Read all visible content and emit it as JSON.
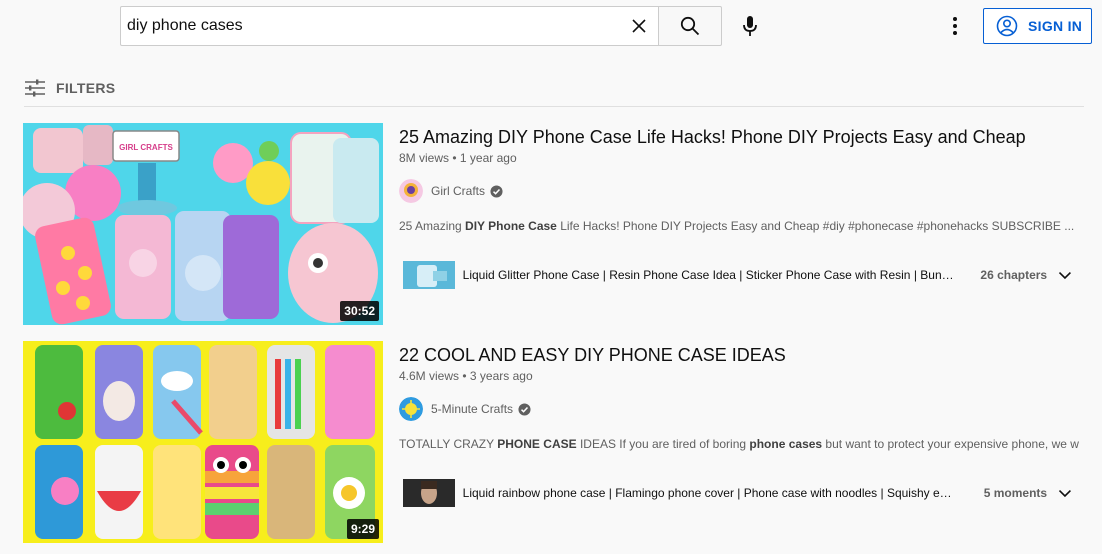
{
  "search": {
    "query": "diy phone cases"
  },
  "header": {
    "sign_in_label": "SIGN IN"
  },
  "filters": {
    "label": "FILTERS"
  },
  "results": [
    {
      "title": "25 Amazing DIY Phone Case Life Hacks! Phone DIY Projects Easy and Cheap",
      "views": "8M views",
      "age": "1 year ago",
      "channel": "Girl Crafts",
      "duration": "30:52",
      "thumb_text": "GIRL CRAFTS",
      "desc_parts": [
        "25 Amazing ",
        "DIY Phone Case",
        " Life Hacks! Phone DIY Projects Easy and Cheap #diy #phonecase #phonehacks SUBSCRIBE ..."
      ],
      "chapter_text": "Liquid Glitter Phone Case | Resin Phone Case Idea | Sticker Phone Case with Resin | Bunny Phone Case",
      "chapter_count": "26 chapters"
    },
    {
      "title": "22 COOL AND EASY DIY PHONE CASE IDEAS",
      "views": "4.6M views",
      "age": "3 years ago",
      "channel": "5-Minute Crafts",
      "duration": "9:29",
      "desc_parts": [
        "TOTALLY CRAZY ",
        "PHONE CASE",
        " IDEAS If you are tired of boring ",
        "phone cases",
        " but want to protect your expensive phone, we will ..."
      ],
      "chapter_text": "Liquid rainbow phone case | Flamingo phone cover | Phone case with noodles | Squishy egg phone case",
      "chapter_count": "5 moments"
    }
  ],
  "colors": {
    "accent": "#065fd4",
    "thumb1_bg": "#4fd6ea",
    "thumb2_bg": "#f7ee1c"
  }
}
